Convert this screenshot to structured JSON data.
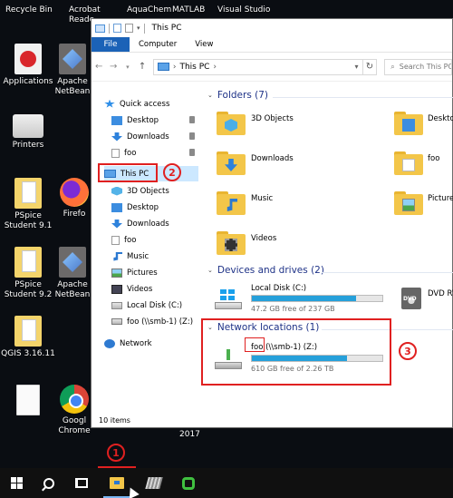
{
  "desktop": {
    "top_labels": [
      "Recycle Bin",
      "Acrobat",
      "AquaChem",
      "MATLAB",
      "Visual Studio"
    ],
    "top_label_2": "Reade",
    "icons": [
      {
        "label": "Applications"
      },
      {
        "label": "Apache\nNetBean"
      },
      {
        "label": "Printers"
      },
      {
        "label": "PSpice\nStudent 9.1"
      },
      {
        "label": "Firefo"
      },
      {
        "label": "PSpice\nStudent 9.2"
      },
      {
        "label": "Apache\nNetBean"
      },
      {
        "label": "QGIS 3.16.11"
      },
      {
        "label": ""
      },
      {
        "label": "Googl\nChrome"
      }
    ],
    "year_text": "2017"
  },
  "window": {
    "title": "This PC",
    "ribbon_tabs": [
      "File",
      "Computer",
      "View"
    ],
    "address": "This PC",
    "search_placeholder": "Search This PC",
    "nav_pane": [
      {
        "label": "Quick access",
        "icon": "star"
      },
      {
        "label": "Desktop",
        "icon": "desktop",
        "pinned": true
      },
      {
        "label": "Downloads",
        "icon": "download",
        "pinned": true
      },
      {
        "label": "foo",
        "icon": "file",
        "pinned": true
      },
      {
        "label": "This PC",
        "icon": "pc"
      },
      {
        "label": "3D Objects",
        "icon": "3d"
      },
      {
        "label": "Desktop",
        "icon": "desktop"
      },
      {
        "label": "Downloads",
        "icon": "download"
      },
      {
        "label": "foo",
        "icon": "file"
      },
      {
        "label": "Music",
        "icon": "music"
      },
      {
        "label": "Pictures",
        "icon": "pictures"
      },
      {
        "label": "Videos",
        "icon": "videos"
      },
      {
        "label": "Local Disk (C:)",
        "icon": "disk"
      },
      {
        "label": "foo (\\\\smb-1) (Z:)",
        "icon": "netdrive"
      },
      {
        "label": "Network",
        "icon": "network"
      }
    ],
    "folders_header": "Folders (7)",
    "folders": [
      {
        "label": "3D Objects"
      },
      {
        "label": "Desktop"
      },
      {
        "label": "Downloads"
      },
      {
        "label": "foo"
      },
      {
        "label": "Music"
      },
      {
        "label": "Pictures"
      },
      {
        "label": "Videos"
      }
    ],
    "devices_header": "Devices and drives (2)",
    "devices": [
      {
        "label": "Local Disk (C:)",
        "free": "47.2 GB free of 237 GB",
        "used_fraction": 0.8
      },
      {
        "label": "DVD RW"
      }
    ],
    "network_header": "Network locations (1)",
    "network": [
      {
        "label_name": "foo",
        "label_rest": " (\\\\smb-1) (Z:)",
        "free": "610 GB free of 2.26 TB",
        "used_fraction": 0.73
      }
    ],
    "status": "10 items"
  },
  "annotations": [
    "1",
    "2",
    "3"
  ]
}
